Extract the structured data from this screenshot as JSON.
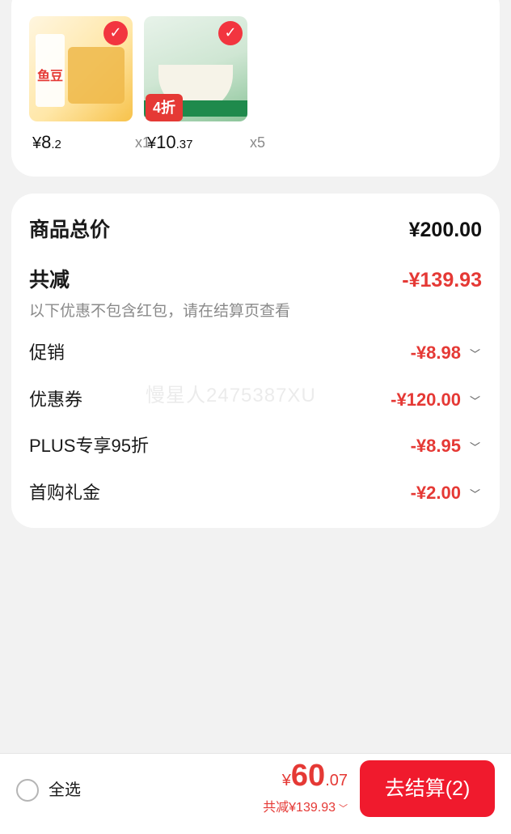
{
  "products": [
    {
      "price_symbol": "¥",
      "price_int": "8",
      "price_dec": ".2",
      "qty": "x1",
      "image": "fish-tofu-package",
      "thumb_text": "鱼豆"
    },
    {
      "price_symbol": "¥",
      "price_int": "10",
      "price_dec": ".37",
      "qty": "x5",
      "image": "pickled-fish-package",
      "thumb_badge": "4折"
    }
  ],
  "summary": {
    "total_label": "商品总价",
    "total_value": "¥200.00",
    "discount_label": "共减",
    "discount_value": "-¥139.93",
    "note": "以下优惠不包含红包，请在结算页查看",
    "items": [
      {
        "label": "促销",
        "value": "-¥8.98"
      },
      {
        "label": "优惠券",
        "value": "-¥120.00"
      },
      {
        "label": "PLUS专享95折",
        "value": "-¥8.95"
      },
      {
        "label": "首购礼金",
        "value": "-¥2.00"
      }
    ]
  },
  "watermark": "慢星人2475387XU",
  "bottom_bar": {
    "select_all": "全选",
    "price_symbol": "¥",
    "price_int": "60",
    "price_dec": ".07",
    "saved": "共减¥139.93",
    "checkout": "去结算(2)"
  },
  "colors": {
    "accent": "#f01a2d",
    "discount_red": "#e53935"
  },
  "icons": {
    "chevron": "chevron-down-icon",
    "check": "check-icon",
    "radio": "radio-unchecked-icon"
  }
}
